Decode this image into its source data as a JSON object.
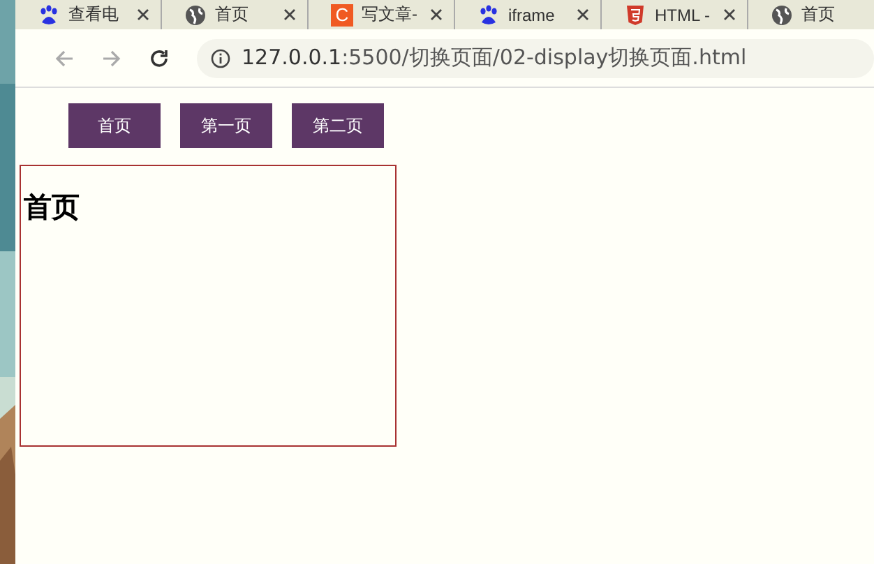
{
  "tabs": [
    {
      "kind": "paw",
      "title": "查看电",
      "close_button": true
    },
    {
      "kind": "globe",
      "title": "首页",
      "close_button": true
    },
    {
      "kind": "badge",
      "badge_text": "C",
      "title": "写文章-",
      "close_button": true
    },
    {
      "kind": "paw",
      "title": "iframe",
      "close_button": true
    },
    {
      "kind": "shield",
      "title": "HTML -",
      "close_button": true
    },
    {
      "kind": "globe",
      "title": "首页",
      "close_button": false
    }
  ],
  "address": {
    "host": "127.0.0.1",
    "rest": ":5500/切换页面/02-display切换页面.html"
  },
  "nav_buttons": [
    "首页",
    "第一页",
    "第二页"
  ],
  "panel": {
    "heading": "首页"
  }
}
